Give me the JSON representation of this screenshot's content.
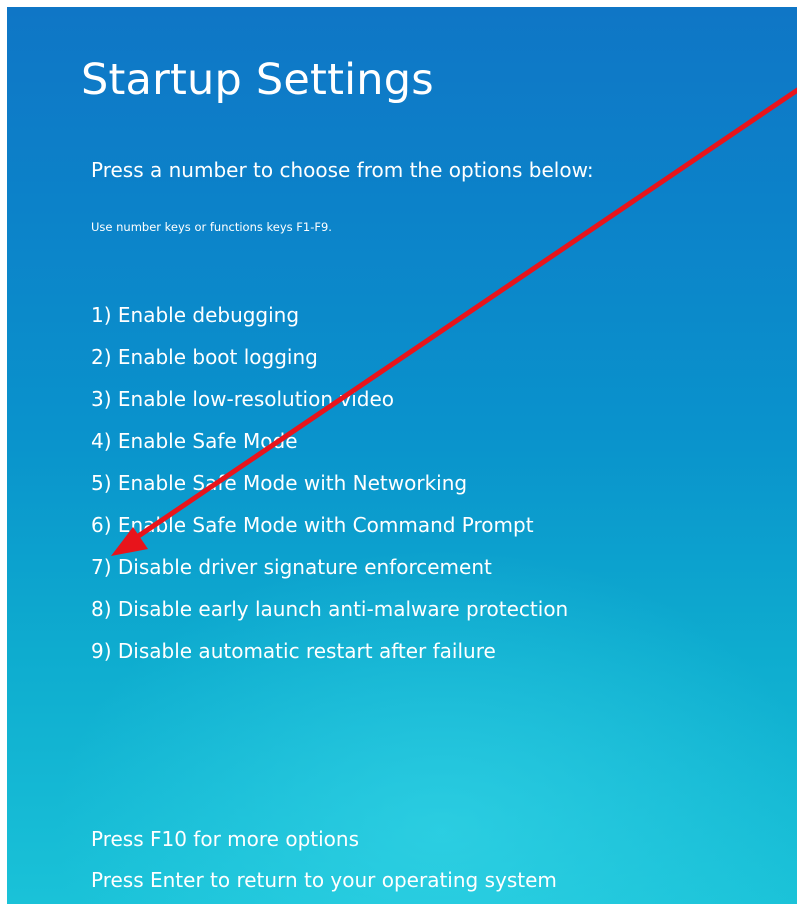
{
  "screen": {
    "title": "Startup Settings",
    "prompt": "Press a number to choose from the options below:",
    "hint": "Use number keys or functions keys F1-F9."
  },
  "options": [
    {
      "label": "1) Enable debugging"
    },
    {
      "label": "2) Enable boot logging"
    },
    {
      "label": "3) Enable low-resolution video"
    },
    {
      "label": "4) Enable Safe Mode"
    },
    {
      "label": "5) Enable Safe Mode with Networking"
    },
    {
      "label": "6) Enable Safe Mode with Command Prompt"
    },
    {
      "label": "7) Disable driver signature enforcement"
    },
    {
      "label": "8) Disable early launch anti-malware protection"
    },
    {
      "label": "9) Disable automatic restart after failure"
    }
  ],
  "footer": {
    "more_options": "Press F10 for more options",
    "return": "Press Enter to return to your operating system"
  },
  "annotation": {
    "arrow_color": "#e8141b",
    "points_to_option": 7
  },
  "colors": {
    "background_top": "#0f76c6",
    "background_bottom": "#1ac2d8",
    "text": "#ffffff",
    "frame": "#ffffff"
  }
}
